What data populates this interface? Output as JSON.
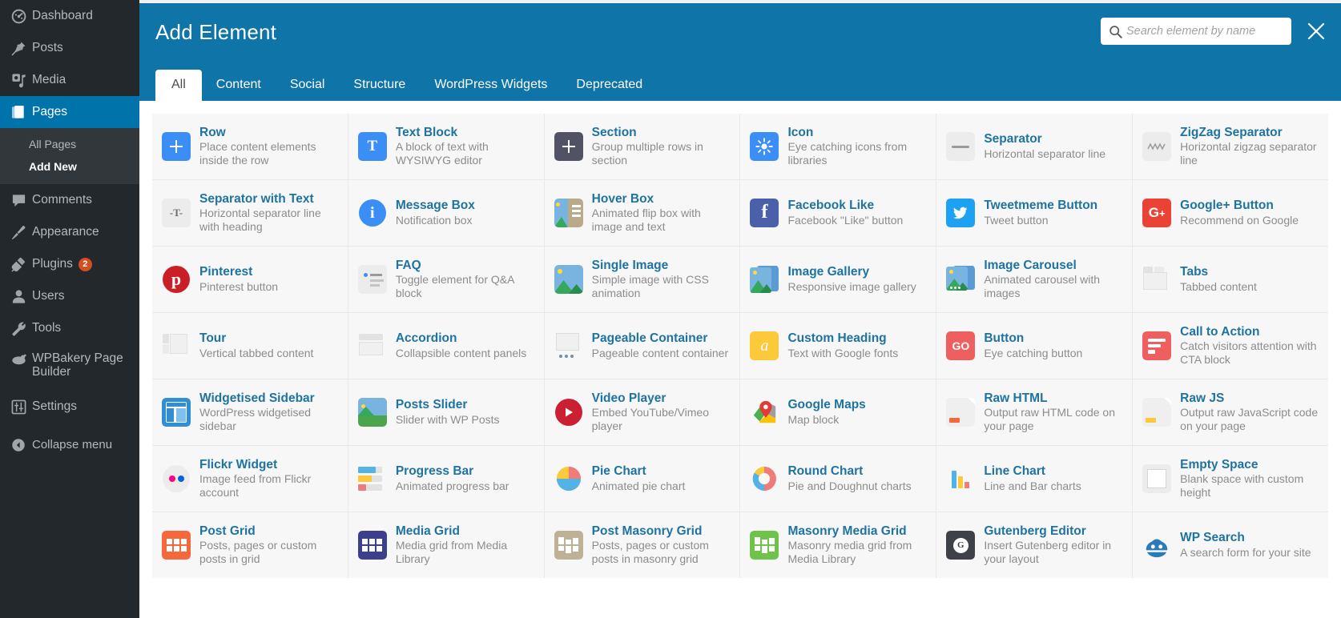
{
  "sidebar": {
    "items": [
      {
        "label": "Dashboard",
        "icon": "dashboard-icon",
        "current": false
      },
      {
        "label": "Posts",
        "icon": "pin-icon",
        "current": false
      },
      {
        "label": "Media",
        "icon": "media-icon",
        "current": false
      },
      {
        "label": "Pages",
        "icon": "pages-icon",
        "current": true
      },
      {
        "label": "Comments",
        "icon": "comment-icon",
        "current": false
      },
      {
        "label": "Appearance",
        "icon": "brush-icon",
        "current": false
      },
      {
        "label": "Plugins",
        "icon": "plug-icon",
        "current": false,
        "badge": "2"
      },
      {
        "label": "Users",
        "icon": "user-icon",
        "current": false
      },
      {
        "label": "Tools",
        "icon": "wrench-icon",
        "current": false
      },
      {
        "label": "WPBakery Page Builder",
        "icon": "wpbakery-icon",
        "current": false
      },
      {
        "label": "Settings",
        "icon": "settings-icon",
        "current": false
      }
    ],
    "submenu": [
      {
        "label": "All Pages",
        "current": false
      },
      {
        "label": "Add New",
        "current": true
      }
    ],
    "collapse_label": "Collapse menu"
  },
  "modal": {
    "title": "Add Element",
    "close_label": "Close",
    "search": {
      "placeholder": "Search element by name",
      "value": ""
    },
    "tabs": [
      {
        "label": "All",
        "active": true
      },
      {
        "label": "Content",
        "active": false
      },
      {
        "label": "Social",
        "active": false
      },
      {
        "label": "Structure",
        "active": false
      },
      {
        "label": "WordPress Widgets",
        "active": false
      },
      {
        "label": "Deprecated",
        "active": false
      }
    ]
  },
  "elements": [
    {
      "name": "Row",
      "desc": "Place content elements inside the row",
      "icon": "plus-square-blue"
    },
    {
      "name": "Text Block",
      "desc": "A block of text with WYSIWYG editor",
      "icon": "letter-t-blue"
    },
    {
      "name": "Section",
      "desc": "Group multiple rows in section",
      "icon": "plus-square-dark"
    },
    {
      "name": "Icon",
      "desc": "Eye catching icons from libraries",
      "icon": "sun-blue"
    },
    {
      "name": "Separator",
      "desc": "Horizontal separator line",
      "icon": "separator-line"
    },
    {
      "name": "ZigZag Separator",
      "desc": "Horizontal zigzag separator line",
      "icon": "zigzag-line"
    },
    {
      "name": "Separator with Text",
      "desc": "Horizontal separator line with heading",
      "icon": "separator-text"
    },
    {
      "name": "Message Box",
      "desc": "Notification box",
      "icon": "info-circle-blue"
    },
    {
      "name": "Hover Box",
      "desc": "Animated flip box with image and text",
      "icon": "hover-box"
    },
    {
      "name": "Facebook Like",
      "desc": "Facebook \"Like\" button",
      "icon": "facebook"
    },
    {
      "name": "Tweetmeme Button",
      "desc": "Tweet button",
      "icon": "twitter"
    },
    {
      "name": "Google+ Button",
      "desc": "Recommend on Google",
      "icon": "googleplus"
    },
    {
      "name": "Pinterest",
      "desc": "Pinterest button",
      "icon": "pinterest"
    },
    {
      "name": "FAQ",
      "desc": "Toggle element for Q&A block",
      "icon": "faq-toggle"
    },
    {
      "name": "Single Image",
      "desc": "Simple image with CSS animation",
      "icon": "image"
    },
    {
      "name": "Image Gallery",
      "desc": "Responsive image gallery",
      "icon": "image-gallery"
    },
    {
      "name": "Image Carousel",
      "desc": "Animated carousel with images",
      "icon": "image-carousel"
    },
    {
      "name": "Tabs",
      "desc": "Tabbed content",
      "icon": "tabs"
    },
    {
      "name": "Tour",
      "desc": "Vertical tabbed content",
      "icon": "tour"
    },
    {
      "name": "Accordion",
      "desc": "Collapsible content panels",
      "icon": "accordion"
    },
    {
      "name": "Pageable Container",
      "desc": "Pageable content container",
      "icon": "pageable"
    },
    {
      "name": "Custom Heading",
      "desc": "Text with Google fonts",
      "icon": "custom-heading"
    },
    {
      "name": "Button",
      "desc": "Eye catching button",
      "icon": "go-button"
    },
    {
      "name": "Call to Action",
      "desc": "Catch visitors attention with CTA block",
      "icon": "cta"
    },
    {
      "name": "Widgetised Sidebar",
      "desc": "WordPress widgetised sidebar",
      "icon": "widgetised-sidebar"
    },
    {
      "name": "Posts Slider",
      "desc": "Slider with WP Posts",
      "icon": "posts-slider"
    },
    {
      "name": "Video Player",
      "desc": "Embed YouTube/Vimeo player",
      "icon": "video-play"
    },
    {
      "name": "Google Maps",
      "desc": "Map block",
      "icon": "google-maps"
    },
    {
      "name": "Raw HTML",
      "desc": "Output raw HTML code on your page",
      "icon": "raw-html"
    },
    {
      "name": "Raw JS",
      "desc": "Output raw JavaScript code on your page",
      "icon": "raw-js"
    },
    {
      "name": "Flickr Widget",
      "desc": "Image feed from Flickr account",
      "icon": "flickr"
    },
    {
      "name": "Progress Bar",
      "desc": "Animated progress bar",
      "icon": "progress-bar"
    },
    {
      "name": "Pie Chart",
      "desc": "Animated pie chart",
      "icon": "pie-chart"
    },
    {
      "name": "Round Chart",
      "desc": "Pie and Doughnut charts",
      "icon": "round-chart"
    },
    {
      "name": "Line Chart",
      "desc": "Line and Bar charts",
      "icon": "line-chart"
    },
    {
      "name": "Empty Space",
      "desc": "Blank space with custom height",
      "icon": "empty-space"
    },
    {
      "name": "Post Grid",
      "desc": "Posts, pages or custom posts in grid",
      "icon": "post-grid"
    },
    {
      "name": "Media Grid",
      "desc": "Media grid from Media Library",
      "icon": "media-grid"
    },
    {
      "name": "Post Masonry Grid",
      "desc": "Posts, pages or custom posts in masonry grid",
      "icon": "post-masonry-grid"
    },
    {
      "name": "Masonry Media Grid",
      "desc": "Masonry media grid from Media Library",
      "icon": "masonry-media-grid"
    },
    {
      "name": "Gutenberg Editor",
      "desc": "Insert Gutenberg editor in your layout",
      "icon": "gutenberg"
    },
    {
      "name": "WP Search",
      "desc": "A search form for your site",
      "icon": "wp-search"
    }
  ],
  "colors": {
    "accent": "#0f74a8",
    "sidebar_bg": "#23282d",
    "link": "#1e73a0",
    "badge": "#d54e21"
  }
}
